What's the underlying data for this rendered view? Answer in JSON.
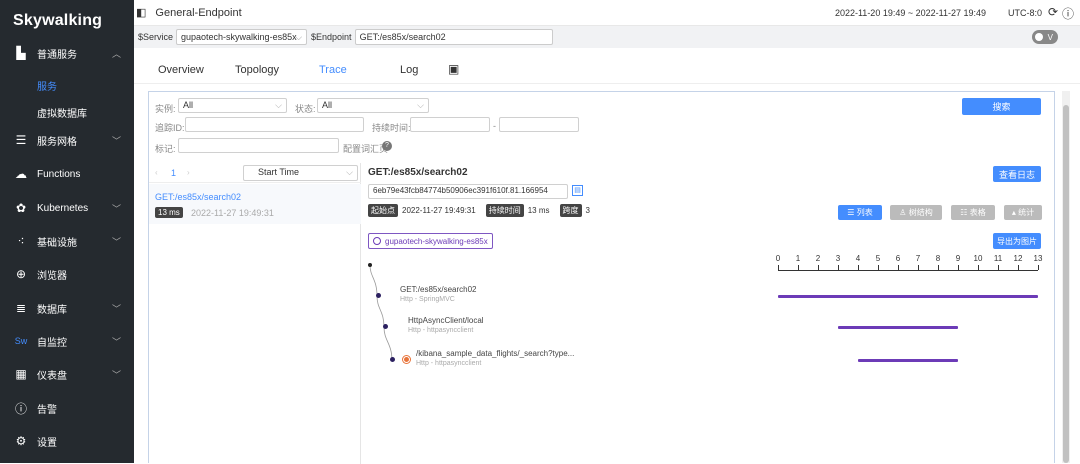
{
  "logo": "Skywalking",
  "sidebar": {
    "items": [
      {
        "label": "普通服务",
        "icon": "bar-chart-icon"
      },
      {
        "label": "服务网格",
        "icon": "server-stack-icon"
      },
      {
        "label": "Functions",
        "icon": "cloud-icon"
      },
      {
        "label": "Kubernetes",
        "icon": "kubernetes-icon"
      },
      {
        "label": "基础设施",
        "icon": "infrastructure-icon"
      },
      {
        "label": "浏览器",
        "icon": "globe-icon"
      },
      {
        "label": "数据库",
        "icon": "database-icon"
      },
      {
        "label": "自监控",
        "icon": "sw-icon"
      },
      {
        "label": "仪表盘",
        "icon": "dashboard-icon"
      },
      {
        "label": "告警",
        "icon": "alert-icon"
      },
      {
        "label": "设置",
        "icon": "gear-icon"
      }
    ],
    "sub": [
      {
        "label": "服务"
      },
      {
        "label": "虚拟数据库"
      }
    ]
  },
  "topbar": {
    "title": "General-Endpoint",
    "range": "2022-11-20 19:49 ~ 2022-11-27 19:49",
    "tz": "UTC-8:0"
  },
  "filter": {
    "service_label": "$Service",
    "service_value": "gupaotech-skywalking-es85x",
    "endpoint_label": "$Endpoint",
    "endpoint_value": "GET:/es85x/search02",
    "toggle": "V"
  },
  "tabs": [
    "Overview",
    "Topology",
    "Trace",
    "Log"
  ],
  "search": {
    "instance_label": "实例:",
    "instance_value": "All",
    "state_label": "状态:",
    "state_value": "All",
    "trace_label": "追踪ID:",
    "duration_label": "持续时间:",
    "tag_label": "标记:",
    "config_label": "配置词汇页",
    "button": "搜索",
    "dash": "-"
  },
  "list": {
    "page": "1",
    "sort": "Start Time",
    "items": [
      {
        "name": "GET:/es85x/search02",
        "duration": "13 ms",
        "time": "2022-11-27 19:49:31"
      }
    ]
  },
  "detail": {
    "title": "GET:/es85x/search02",
    "log_button": "查看日志",
    "trace_id": "6eb79e43fcb84774b50906ec391f610f.81.166954",
    "start_label": "起始点",
    "start_value": "2022-11-27 19:49:31",
    "duration_label": "持续时间",
    "duration_value": "13 ms",
    "span_label": "跨度",
    "span_value": "3",
    "view_list": "列表",
    "view_tree": "树结构",
    "view_table": "表格",
    "view_stats": "统计",
    "service_tag": "gupaotech-skywalking-es85x",
    "export_button": "导出为图片"
  },
  "timeline": {
    "ticks": [
      "0",
      "1",
      "2",
      "3",
      "4",
      "5",
      "6",
      "7",
      "8",
      "9",
      "10",
      "11",
      "12",
      "13"
    ],
    "spans": [
      {
        "name": "GET:/es85x/search02",
        "sub": "Http - SpringMVC",
        "start": 0,
        "end": 13,
        "color": "#6c3bb7"
      },
      {
        "name": "HttpAsyncClient/local",
        "sub": "Http - httpasyncclient",
        "start": 3,
        "end": 9,
        "color": "#6c3bb7"
      },
      {
        "name": "/kibana_sample_data_flights/_search?type...",
        "sub": "Http - httpasyncclient",
        "start": 4,
        "end": 9,
        "color": "#6c3bb7"
      }
    ]
  },
  "colors": {
    "accent": "#448dfe",
    "sidebar": "#252a2f",
    "span": "#6c3bb7",
    "error_dot": "#e8743b"
  }
}
